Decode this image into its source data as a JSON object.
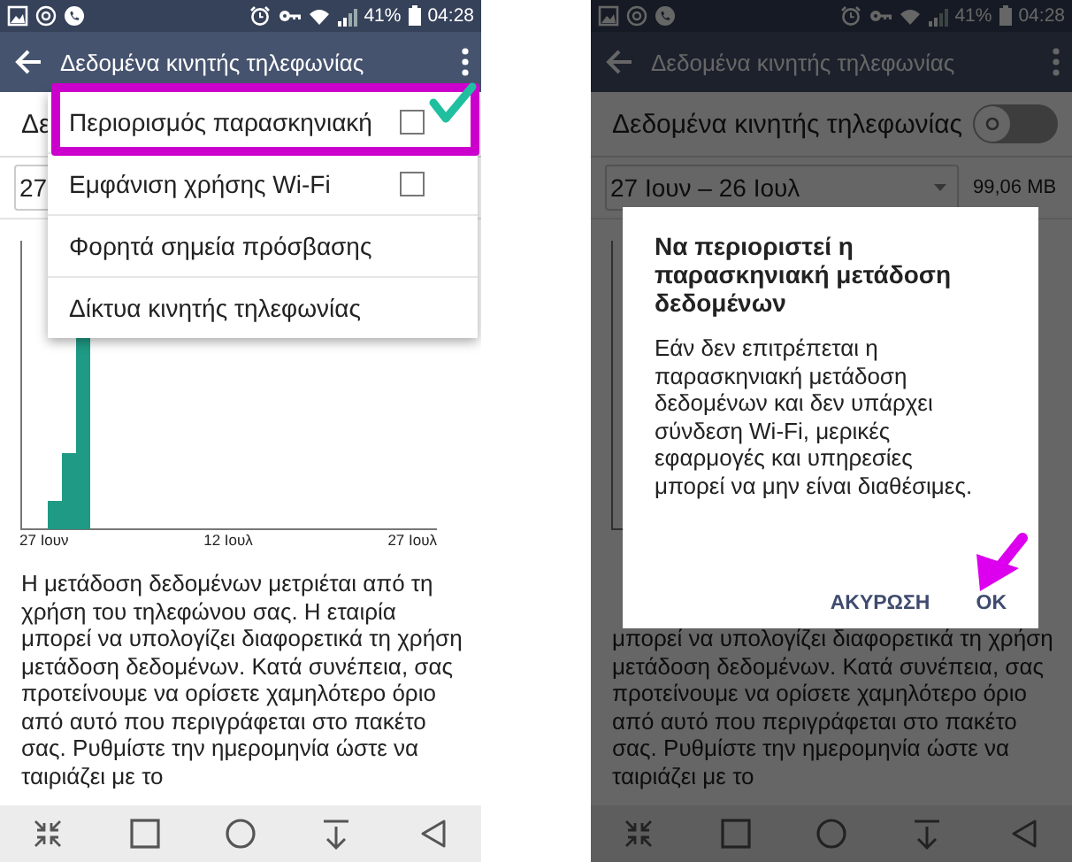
{
  "screens": [
    {
      "status_bar": {
        "battery": "41%",
        "time": "04:28"
      },
      "app_bar": {
        "title": "Δεδομένα κινητής τηλεφωνίας"
      },
      "mobile_data": {
        "label": "Δε"
      },
      "date_range": {
        "value": "27"
      },
      "chart": {
        "x_labels": [
          "27 Ιουν",
          "12 Ιουλ",
          "27 Ιουλ"
        ]
      },
      "info_text": "Η μετάδοση δεδομένων μετριέται από τη χρήση του τηλεφώνου σας. Η εταιρία μπορεί να υπολογίζει διαφορετικά τη χρήση μετάδοση δεδομένων. Κατά συνέπεια, σας προτείνουμε να ορίσετε χαμηλότερο όριο από αυτό που περιγράφεται στο πακέτο σας. Ρυθμίστε την ημερομηνία ώστε να ταιριάζει με το",
      "overflow_menu": {
        "items": [
          {
            "label": "Περιορισμός παρασκηνιακή",
            "kind": "checkbox",
            "checked": false
          },
          {
            "label": "Εμφάνιση χρήσης Wi-Fi",
            "kind": "checkbox",
            "checked": false
          },
          {
            "label": "Φορητά σημεία πρόσβασης",
            "kind": "plain"
          },
          {
            "label": "Δίκτυα κινητής τηλεφωνίας",
            "kind": "plain"
          }
        ]
      },
      "annotations": [
        {
          "kind": "highlight"
        },
        {
          "kind": "check"
        }
      ]
    },
    {
      "status_bar": {
        "battery": "41%",
        "time": "04:28"
      },
      "app_bar": {
        "title": "Δεδομένα κινητής τηλεφωνίας"
      },
      "mobile_data": {
        "label": "Δεδομένα κινητής τηλεφωνίας",
        "on": false
      },
      "date_range": {
        "value": "27 Ιουν – 26 Ιουλ",
        "usage": "99,06 MB"
      },
      "info_text": "μπορεί να υπολογίζει διαφορετικά τη χρήση μετάδοση δεδομένων. Κατά συνέπεια, σας προτείνουμε να ορίσετε χαμηλότερο όριο από αυτό που περιγράφεται στο πακέτο σας. Ρυθμίστε την ημερομηνία ώστε να ταιριάζει με το",
      "dialog": {
        "title": "Να περιοριστεί η παρασκηνιακή μετάδοση δεδομένων",
        "message": "Εάν δεν επιτρέπεται η παρασκηνιακή μετάδοση δεδομένων και δεν υπάρχει σύνδεση Wi-Fi, μερικές εφαρμογές και υπηρεσίες μπορεί να μην είναι διαθέσιμες.",
        "buttons": [
          "ΑΚΥΡΩΣΗ",
          "OK"
        ]
      },
      "annotations": [
        {
          "kind": "arrow"
        }
      ]
    }
  ]
}
